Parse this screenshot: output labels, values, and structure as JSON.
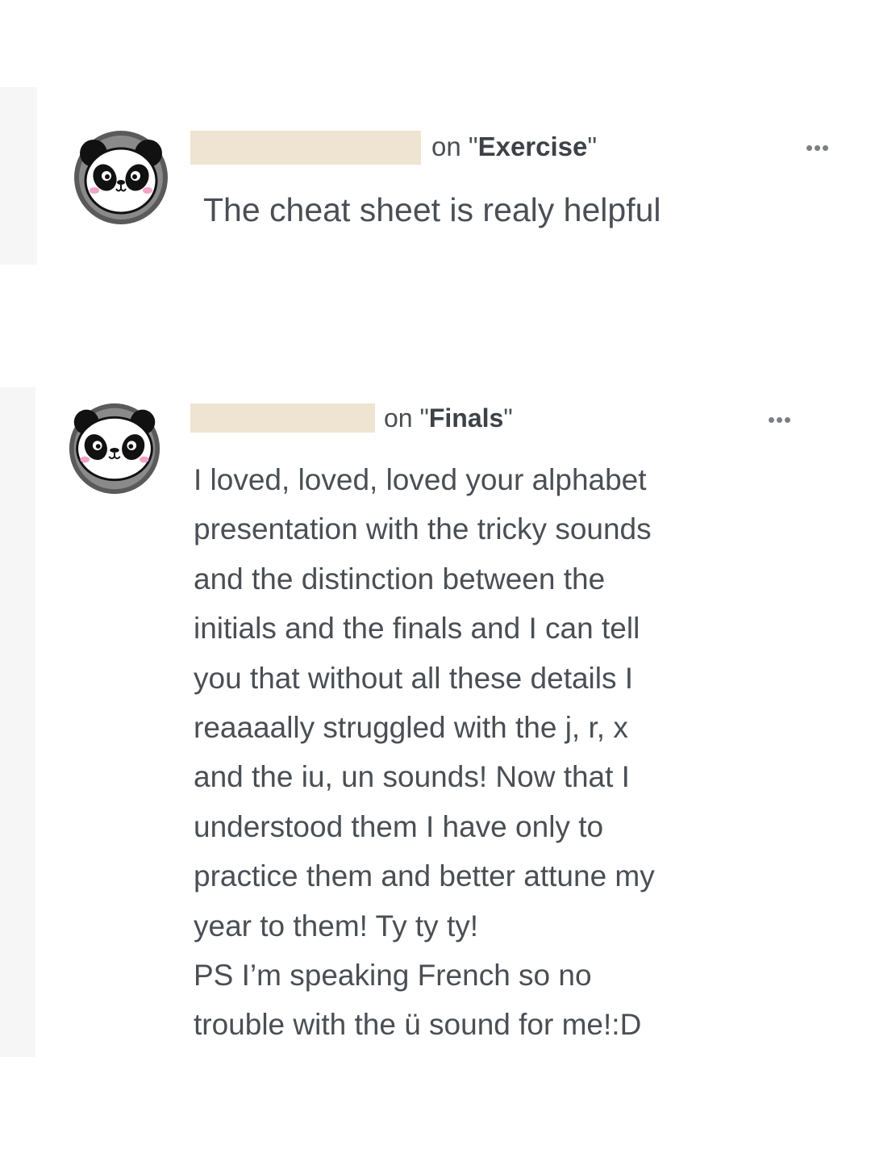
{
  "comments": [
    {
      "username": "",
      "on_prefix": "on \"",
      "topic": "Exercise",
      "on_suffix": "\"",
      "text": "The cheat sheet is realy helpful",
      "avatar_icon": "panda-avatar-icon",
      "menu_icon": "more-horizontal-icon"
    },
    {
      "username": "",
      "on_prefix": "on \"",
      "topic": "Finals",
      "on_suffix": "\"",
      "text": "I loved, loved, loved your alphabet\npresentation with the tricky sounds\nand the distinction between the\ninitials and the finals and I can tell\nyou that without all these details I\nreaaaally struggled with the j, r, x\nand the iu, un sounds! Now that I\nunderstood them I have only to\npractice them and better attune my\nyear to them! Ty ty ty!\nPS I’m speaking French so no\ntrouble with the ü sound for me!:D",
      "avatar_icon": "panda-avatar-icon",
      "menu_icon": "more-horizontal-icon"
    }
  ],
  "colors": {
    "text": "#4a4f55",
    "redaction": "#efe3d1",
    "rail": "#f6f6f6",
    "menu_dots": "#7c8086"
  }
}
